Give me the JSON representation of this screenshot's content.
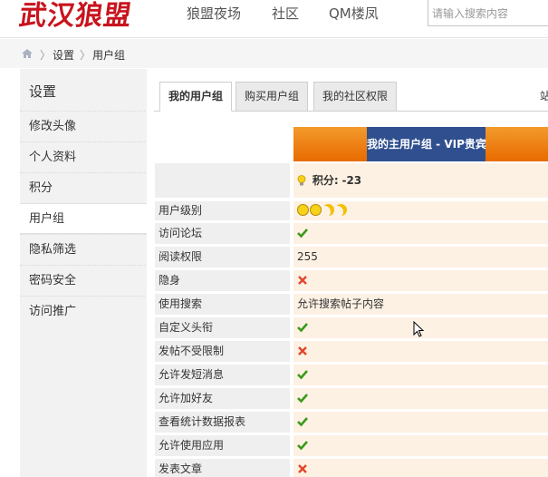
{
  "header": {
    "logo": "武汉狼盟",
    "nav": [
      "狼盟夜场",
      "社区",
      "QM楼凤"
    ],
    "search_placeholder": "请输入搜索内容"
  },
  "breadcrumb": [
    "设置",
    "用户组"
  ],
  "sidebar": {
    "title": "设置",
    "items": [
      "修改头像",
      "个人资料",
      "积分",
      "用户组",
      "隐私筛选",
      "密码安全",
      "访问推广"
    ],
    "active": "用户组"
  },
  "tabs": {
    "items": [
      "我的用户组",
      "购买用户组",
      "我的社区权限"
    ],
    "active": "我的用户组",
    "extra": "站"
  },
  "group_header": "我的主用户组 - VIP贵宾",
  "score": {
    "label": "积分:",
    "value": "-23"
  },
  "rows": [
    {
      "label": "用户级别",
      "type": "icons"
    },
    {
      "label": "访问论坛",
      "type": "check"
    },
    {
      "label": "阅读权限",
      "type": "text",
      "value": "255"
    },
    {
      "label": "隐身",
      "type": "cross"
    },
    {
      "label": "使用搜索",
      "type": "text",
      "value": "允许搜索帖子内容"
    },
    {
      "label": "自定义头衔",
      "type": "check"
    },
    {
      "label": "发帖不受限制",
      "type": "cross"
    },
    {
      "label": "允许发短消息",
      "type": "check"
    },
    {
      "label": "允许加好友",
      "type": "check"
    },
    {
      "label": "查看统计数据报表",
      "type": "check"
    },
    {
      "label": "允许使用应用",
      "type": "check"
    },
    {
      "label": "发表文章",
      "type": "cross"
    }
  ],
  "colors": {
    "accent_red": "#c8141e",
    "check": "#3a9a1a",
    "cross": "#e2452a",
    "band_orange": "#f07a10",
    "band_blue": "#2f4f8f"
  },
  "level_icons": [
    "smiley-icon",
    "smiley-icon",
    "moon-icon",
    "moon-icon"
  ]
}
